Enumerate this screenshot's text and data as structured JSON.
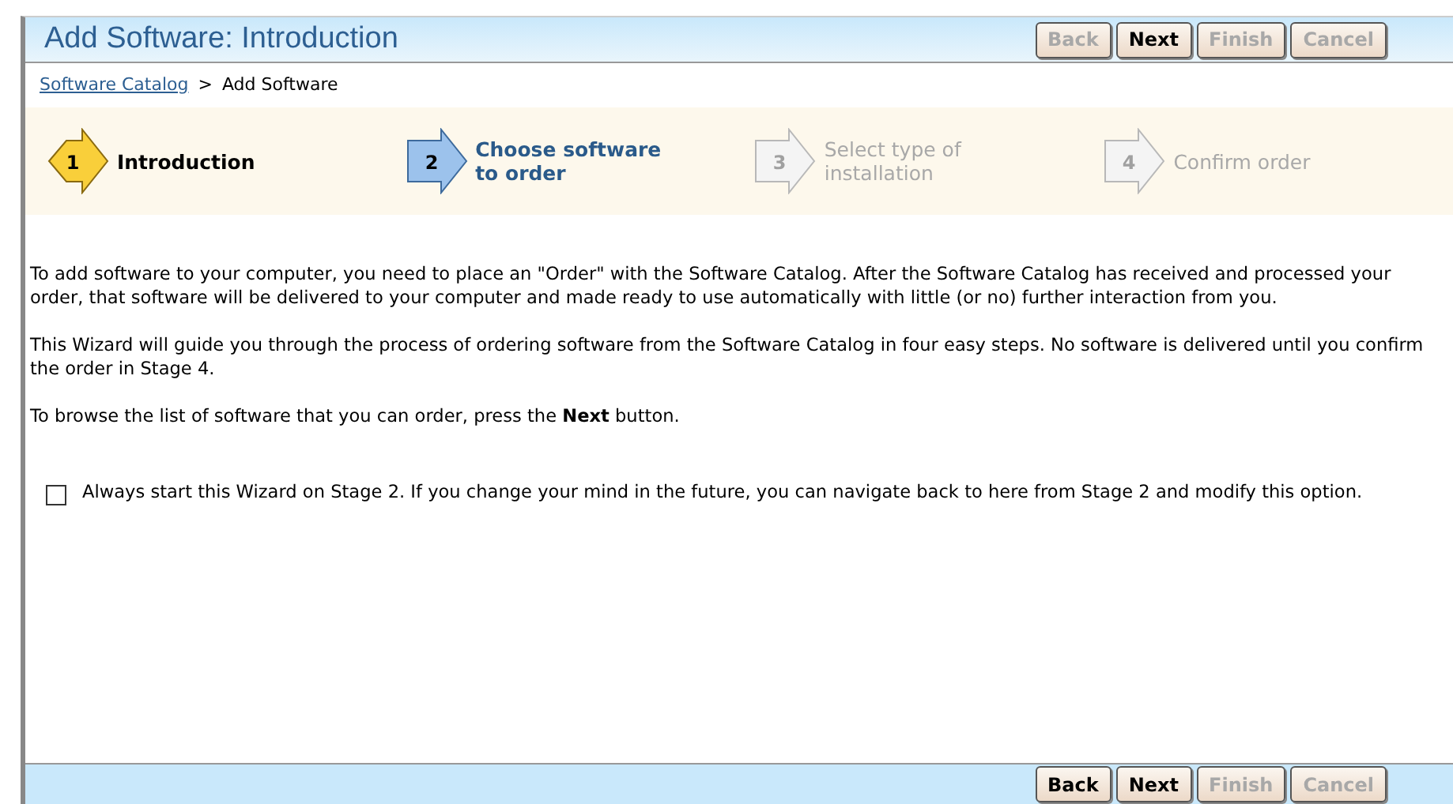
{
  "title": "Add Software: Introduction",
  "top_buttons": [
    {
      "label": "Back",
      "disabled": true
    },
    {
      "label": "Next",
      "disabled": false
    },
    {
      "label": "Finish",
      "disabled": true
    },
    {
      "label": "Cancel",
      "disabled": true
    }
  ],
  "breadcrumb": {
    "link": "Software Catalog",
    "separator": ">",
    "current": "Add Software"
  },
  "steps": [
    {
      "number": "1",
      "label": "Introduction",
      "kind": "current"
    },
    {
      "number": "2",
      "label": "Choose software to order",
      "kind": "next"
    },
    {
      "number": "3",
      "label": "Select type of installation",
      "kind": "pending"
    },
    {
      "number": "4",
      "label": "Confirm order",
      "kind": "pending"
    }
  ],
  "paragraphs": [
    "To add software to your computer, you need to place an \"Order\" with the Software Catalog. After the Software Catalog has received and processed your order, that software will be delivered to your computer and made ready to use automatically with little (or no) further interaction from you.",
    "This Wizard will guide you through the process of ordering software from the Software Catalog in four easy steps. No software is delivered until you confirm the order in Stage 4.",
    "To browse the list of software that you can order, press the **Next** button."
  ],
  "option": {
    "label": "Always start this Wizard on Stage 2. If you change your mind in the future, you can navigate back to here from Stage 2 and modify this option.",
    "checked": false
  },
  "bottom_buttons": [
    {
      "label": "Back",
      "disabled": false
    },
    {
      "label": "Next",
      "disabled": false
    },
    {
      "label": "Finish",
      "disabled": true
    },
    {
      "label": "Cancel",
      "disabled": true
    }
  ]
}
